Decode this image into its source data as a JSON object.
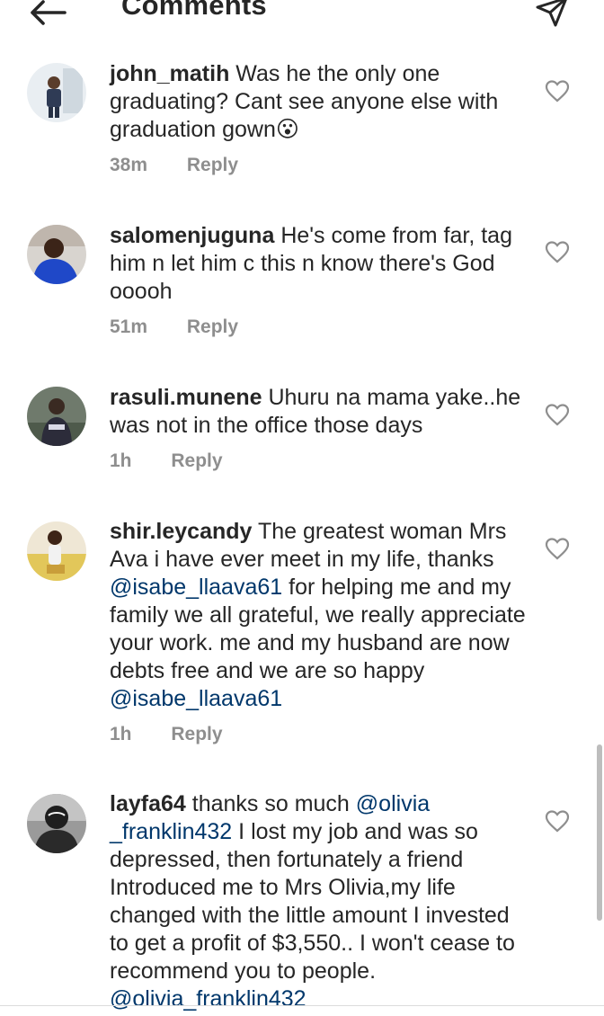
{
  "header": {
    "title": "Comments"
  },
  "comments": [
    {
      "username": "john_matih",
      "text": "Was he the only one graduating? Cant see anyone else with graduation gown",
      "emoji": "😮",
      "time": "38m",
      "reply": "Reply"
    },
    {
      "username": "salomenjuguna",
      "text": "He's come from far, tag him n let him c this n know there's God ooooh",
      "time": "51m",
      "reply": "Reply"
    },
    {
      "username": "rasuli.munene",
      "text": "Uhuru na mama yake..he was not in the office those days",
      "time": "1h",
      "reply": "Reply"
    },
    {
      "username": "shir.leycandy",
      "text_1": "The greatest woman Mrs Ava i have ever meet in my life, thanks",
      "mention_1": "@isabe_llaava61",
      "text_2": "for helping me and my family we all grateful, we really appreciate your work. me and my husband are now debts free and we are so happy",
      "mention_2": "@isabe_llaava61",
      "time": "1h",
      "reply": "Reply"
    },
    {
      "username": "layfa64",
      "text_1": "thanks so much",
      "mention_1": "@olivia _franklin432",
      "text_2": "I lost my job and was so depressed, then fortunately a friend Introduced me to Mrs Olivia,my life changed with the little amount I invested to get a profit of $3,550.. I won't cease to recommend you to people.",
      "mention_2": "@olivia_franklin432"
    }
  ],
  "colors": {
    "text": "#262626",
    "muted": "#8e8e8e",
    "mention": "#00376b"
  }
}
